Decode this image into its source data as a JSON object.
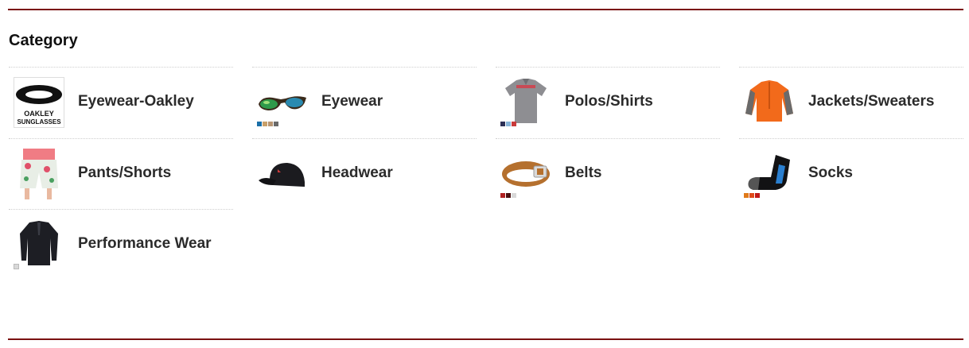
{
  "heading": "Category",
  "categories": [
    {
      "label": "Eyewear-Oakley",
      "icon": "oakley-logo-icon",
      "swatches": []
    },
    {
      "label": "Eyewear",
      "icon": "sunglasses-icon",
      "swatches": [
        "#1a6fa8",
        "#c9a06a",
        "#b79572",
        "#6a6a6a"
      ]
    },
    {
      "label": "Polos/Shirts",
      "icon": "polo-shirt-icon",
      "swatches": [
        "#2b2f55",
        "#87b4d8",
        "#c93a3a"
      ]
    },
    {
      "label": "Jackets/Sweaters",
      "icon": "jacket-icon",
      "swatches": []
    },
    {
      "label": "Pants/Shorts",
      "icon": "shorts-icon",
      "swatches": []
    },
    {
      "label": "Headwear",
      "icon": "cap-icon",
      "swatches": []
    },
    {
      "label": "Belts",
      "icon": "belt-icon",
      "swatches": [
        "#b02020",
        "#4a1010",
        "#d8d8d8"
      ]
    },
    {
      "label": "Socks",
      "icon": "sock-icon",
      "swatches": [
        "#e07a1a",
        "#e04a1a",
        "#c01818"
      ]
    },
    {
      "label": "Performance Wear",
      "icon": "compression-shirt-icon",
      "swatches": [
        "#d8d8d8"
      ]
    }
  ],
  "logo_text": {
    "line1": "OAKLEY",
    "line2": "SUNGLASSES"
  },
  "colors": {
    "accent_rule": "#7a1010"
  }
}
